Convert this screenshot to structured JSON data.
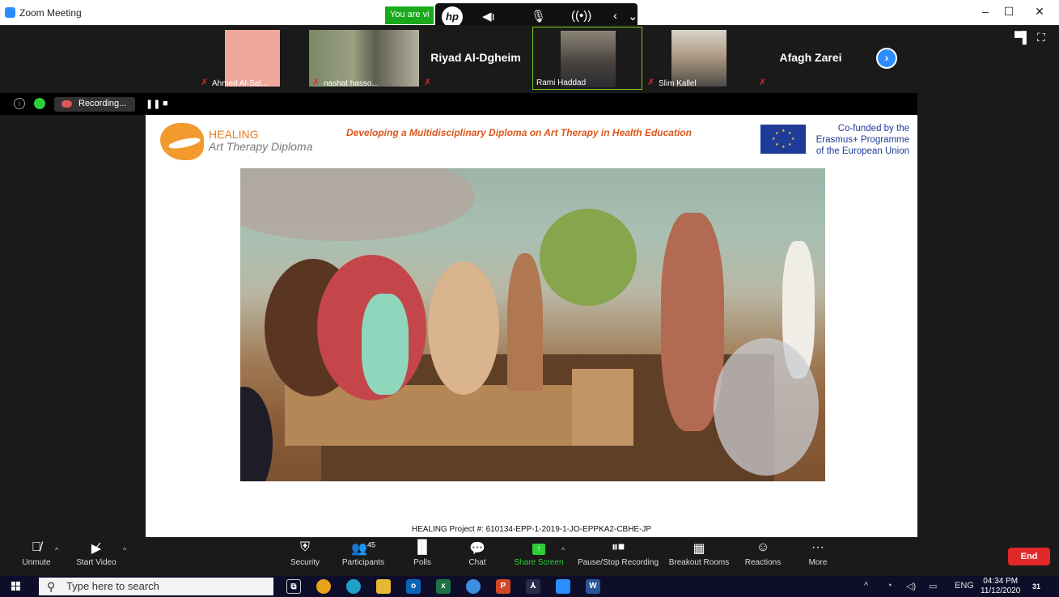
{
  "window": {
    "title": "Zoom Meeting",
    "controls": [
      "–",
      "☐",
      "✕"
    ]
  },
  "share_banner": {
    "text": "You are vi"
  },
  "hp_bar": {
    "logo": "hp",
    "icons": [
      "volume-down",
      "mic",
      "wireless",
      "arrow-left"
    ]
  },
  "participants": [
    {
      "name": "Ahmed Al-Sal...",
      "muted": true,
      "video": true,
      "face_color": "#f0a89c"
    },
    {
      "name": "nashat hasso...",
      "muted": true,
      "video": true,
      "face_color": "#8a8f6e"
    },
    {
      "name": "Riyad Al-Dgheim",
      "muted": true,
      "video": false
    },
    {
      "name": "Rami Haddad",
      "muted": false,
      "video": true,
      "active": true,
      "face_color": "#6d6a63"
    },
    {
      "name": "Slim Kallel",
      "muted": true,
      "video": true,
      "face_color": "#c9c5c0"
    },
    {
      "name": "Afagh Zarei",
      "muted": true,
      "video": false
    }
  ],
  "recording": {
    "label": "Recording..."
  },
  "slide": {
    "logo_line1": "HEALING",
    "logo_line2": "Art Therapy Diploma",
    "headline": "Developing a Multidisciplinary Diploma on Art Therapy in Health Education",
    "eu_text": [
      "Co-funded by the",
      "Erasmus+ Programme",
      "of the European Union"
    ],
    "project_id": "HEALING Project #: 610134-EPP-1-2019-1-JO-EPPKA2-CBHE-JP"
  },
  "toolbar": {
    "unmute": "Unmute",
    "start_video": "Start Video",
    "security": "Security",
    "participants": "Participants",
    "participants_count": "45",
    "polls": "Polls",
    "chat": "Chat",
    "share_screen": "Share Screen",
    "pause_recording": "Pause/Stop Recording",
    "breakout_rooms": "Breakout Rooms",
    "reactions": "Reactions",
    "more": "More",
    "end": "End"
  },
  "taskbar": {
    "search_placeholder": "Type here to search",
    "language": "ENG",
    "time": "04:34 PM",
    "date": "11/12/2020",
    "notifications": "31"
  },
  "colors": {
    "zoom_blue": "#2d8cff",
    "end_red": "#e02828",
    "share_green": "#2dce3a",
    "healing_orange": "#e57f21",
    "eu_blue": "#1f3b99"
  }
}
